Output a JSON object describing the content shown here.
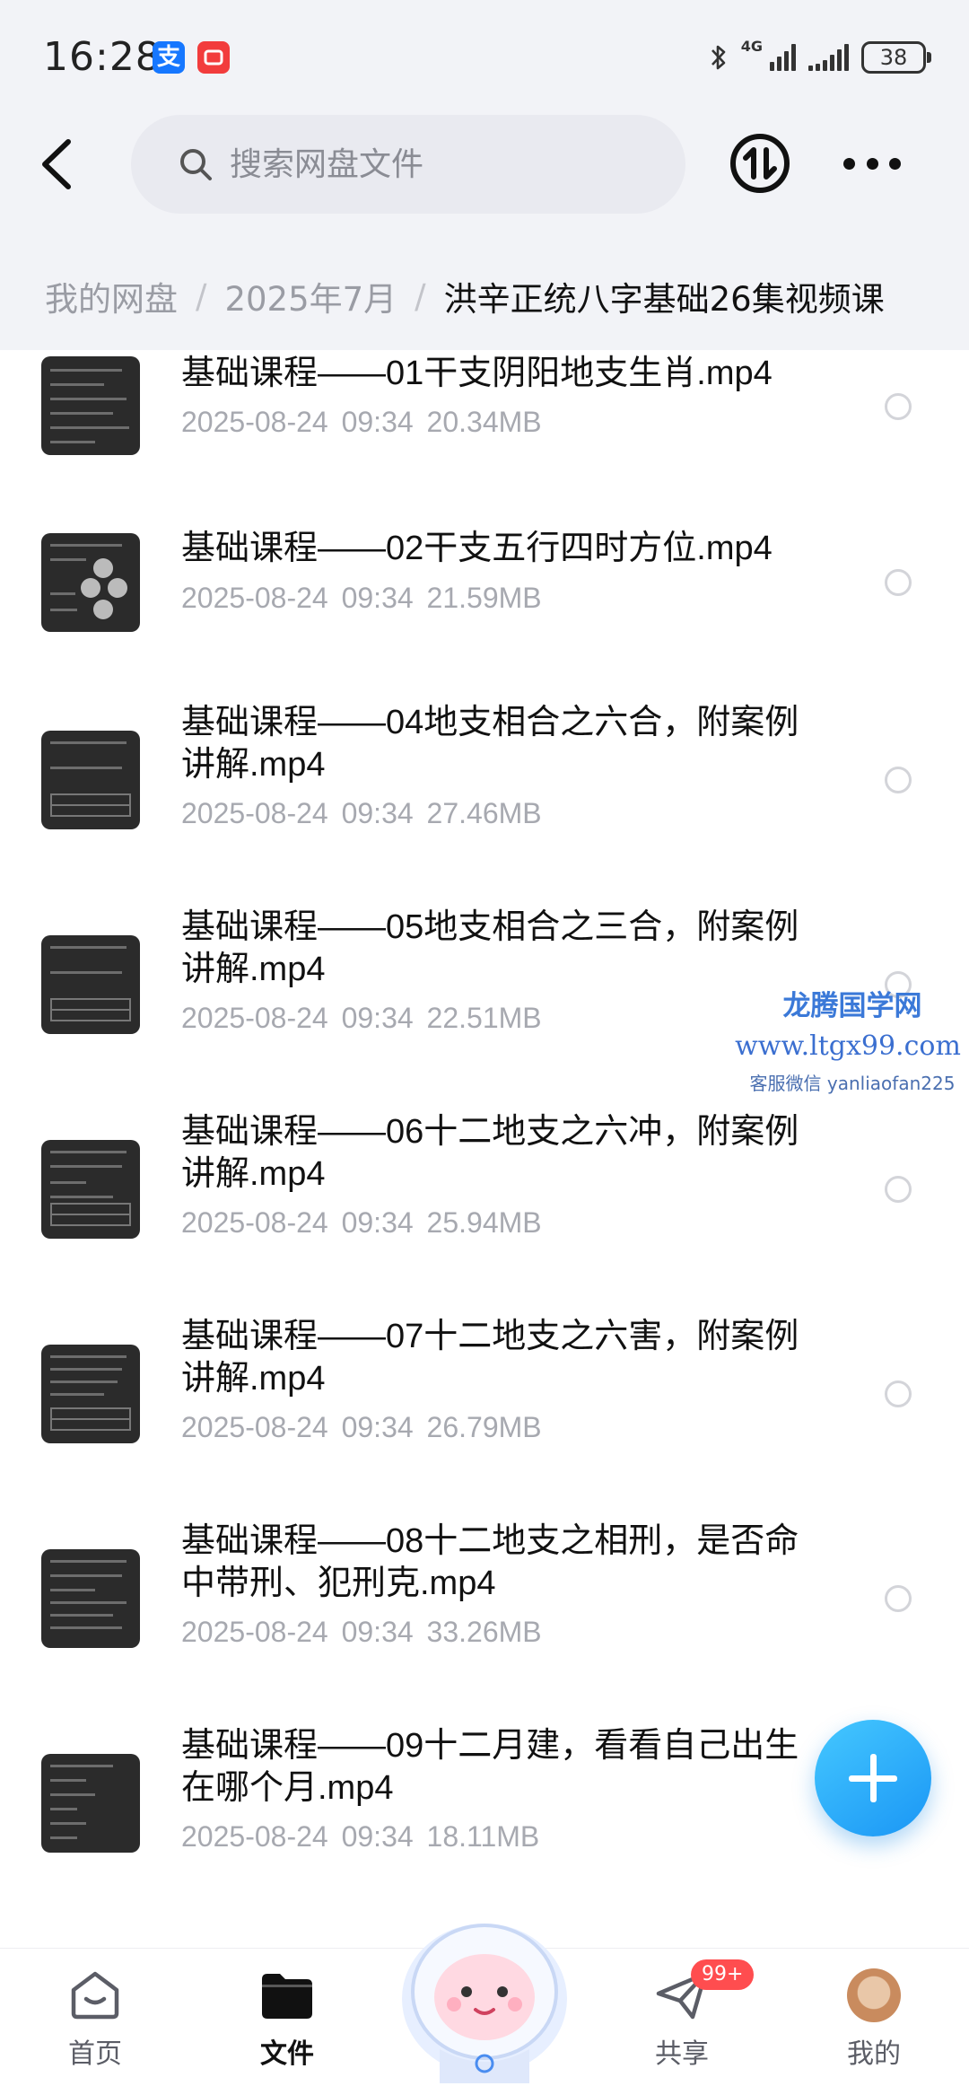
{
  "status_bar": {
    "time": "16:28",
    "app_icon_alipay": "支",
    "network_label": "4G",
    "battery": "38"
  },
  "header": {
    "search_placeholder": "搜索网盘文件"
  },
  "breadcrumb": {
    "items": [
      "我的网盘",
      "2025年7月",
      "洪辛正统八字基础26集视频课"
    ],
    "separator": "/"
  },
  "files": [
    {
      "name": "基础课程——01干支阴阳地支生肖.mp4",
      "date": "2025-08-24",
      "time": "09:34",
      "size": "20.34MB"
    },
    {
      "name": "基础课程——02干支五行四时方位.mp4",
      "date": "2025-08-24",
      "time": "09:34",
      "size": "21.59MB"
    },
    {
      "name": "基础课程——04地支相合之六合，附案例讲解.mp4",
      "date": "2025-08-24",
      "time": "09:34",
      "size": "27.46MB"
    },
    {
      "name": "基础课程——05地支相合之三合，附案例讲解.mp4",
      "date": "2025-08-24",
      "time": "09:34",
      "size": "22.51MB"
    },
    {
      "name": "基础课程——06十二地支之六冲，附案例讲解.mp4",
      "date": "2025-08-24",
      "time": "09:34",
      "size": "25.94MB"
    },
    {
      "name": "基础课程——07十二地支之六害，附案例讲解.mp4",
      "date": "2025-08-24",
      "time": "09:34",
      "size": "26.79MB"
    },
    {
      "name": "基础课程——08十二地支之相刑，是否命中带刑、犯刑克.mp4",
      "date": "2025-08-24",
      "time": "09:34",
      "size": "33.26MB"
    },
    {
      "name": "基础课程——09十二月建，看看自己出生在哪个月.mp4",
      "date": "2025-08-24",
      "time": "09:34",
      "size": "18.11MB"
    }
  ],
  "watermark": {
    "title": "龙腾国学网",
    "url": "www.ltgx99.com",
    "contact": "客服微信 yanliaofan225"
  },
  "bottom_nav": {
    "home": "首页",
    "files": "文件",
    "share": "共享",
    "share_badge": "99+",
    "me": "我的"
  },
  "colors": {
    "accent": "#1a96f5",
    "badge": "#ff4d4f",
    "header_bg": "#f2f3f7"
  }
}
